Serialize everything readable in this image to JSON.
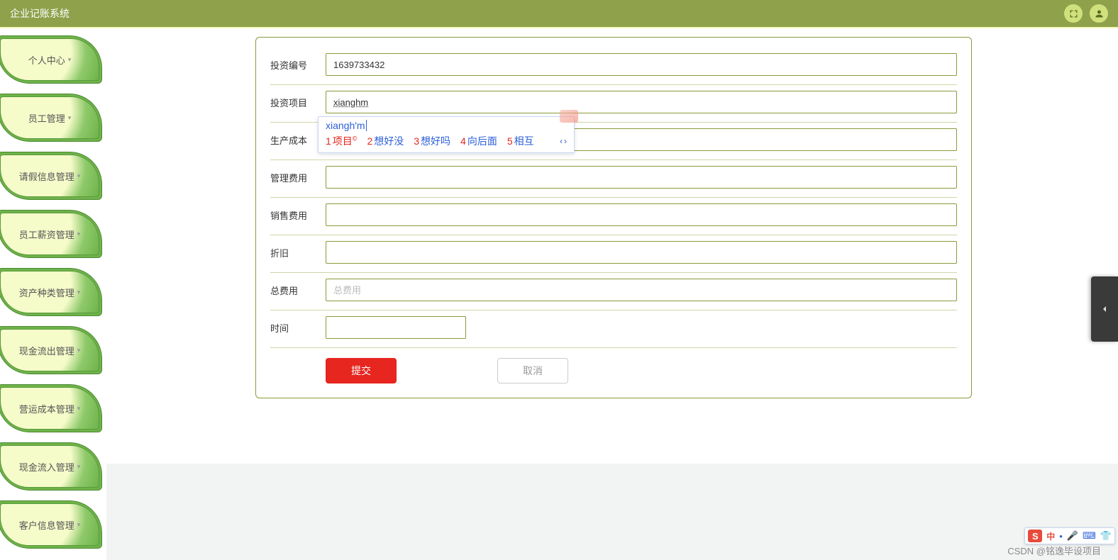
{
  "app": {
    "title": "企业记账系统"
  },
  "header_icons": {
    "fullscreen": "fullscreen-icon",
    "user": "user-icon"
  },
  "sidebar": {
    "items": [
      {
        "label": "个人中心"
      },
      {
        "label": "员工管理"
      },
      {
        "label": "请假信息管理"
      },
      {
        "label": "员工薪资管理"
      },
      {
        "label": "资产种类管理"
      },
      {
        "label": "现金流出管理"
      },
      {
        "label": "营运成本管理"
      },
      {
        "label": "现金流入管理"
      },
      {
        "label": "客户信息管理"
      }
    ]
  },
  "form": {
    "fields": {
      "invest_no": {
        "label": "投资编号",
        "value": "1639733432"
      },
      "invest_proj": {
        "label": "投资项目",
        "value": "xianghm"
      },
      "prod_cost": {
        "label": "生产成本",
        "value": ""
      },
      "mgmt_fee": {
        "label": "管理费用",
        "value": ""
      },
      "sales_fee": {
        "label": "销售费用",
        "value": ""
      },
      "depr": {
        "label": "折旧",
        "value": ""
      },
      "total_fee": {
        "label": "总费用",
        "value": "",
        "placeholder": "总费用"
      },
      "time": {
        "label": "时间",
        "value": ""
      }
    },
    "actions": {
      "submit": "提交",
      "cancel": "取消"
    }
  },
  "ime": {
    "composition": "xiangh'm",
    "candidates": [
      {
        "n": "1",
        "text": "项目",
        "badge": "©"
      },
      {
        "n": "2",
        "text": "想好没"
      },
      {
        "n": "3",
        "text": "想好吗"
      },
      {
        "n": "4",
        "text": "向后面"
      },
      {
        "n": "5",
        "text": "相互"
      }
    ],
    "more": "‹ ›"
  },
  "ime_bar": {
    "brand": "S",
    "lang": "中",
    "icons": [
      "•",
      "🎤",
      "⌨",
      "👕"
    ]
  },
  "footer": {
    "watermark": "CSDN @铭逸毕设项目"
  }
}
